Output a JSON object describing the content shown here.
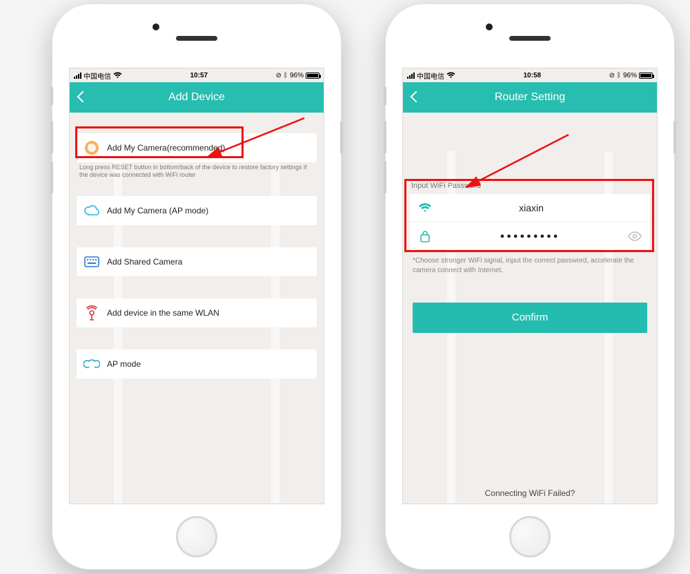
{
  "left": {
    "status": {
      "carrier": "中国电信",
      "time": "10:57",
      "battery": "96%"
    },
    "title": "Add Device",
    "options": [
      {
        "label": "Add My Camera(recommended)"
      },
      {
        "label": "Add My Camera (AP mode)"
      },
      {
        "label": "Add Shared Camera"
      },
      {
        "label": "Add device in the same WLAN"
      },
      {
        "label": "AP mode"
      }
    ],
    "reset_help": "Long press RESET button in bottom/back of the device to restore factory settings if the device was connected with WiFi router"
  },
  "right": {
    "status": {
      "carrier": "中国电信",
      "time": "10:58",
      "battery": "96%"
    },
    "title": "Router Setting",
    "input_label": "Input WiFi Password",
    "ssid": "xiaxin",
    "password_mask": "●●●●●●●●●",
    "note": "*Choose stronger WiFi signal, input the correct password, accelerate the camera connect with Internet.",
    "confirm": "Confirm",
    "footer": "Connecting WiFi Failed?"
  }
}
